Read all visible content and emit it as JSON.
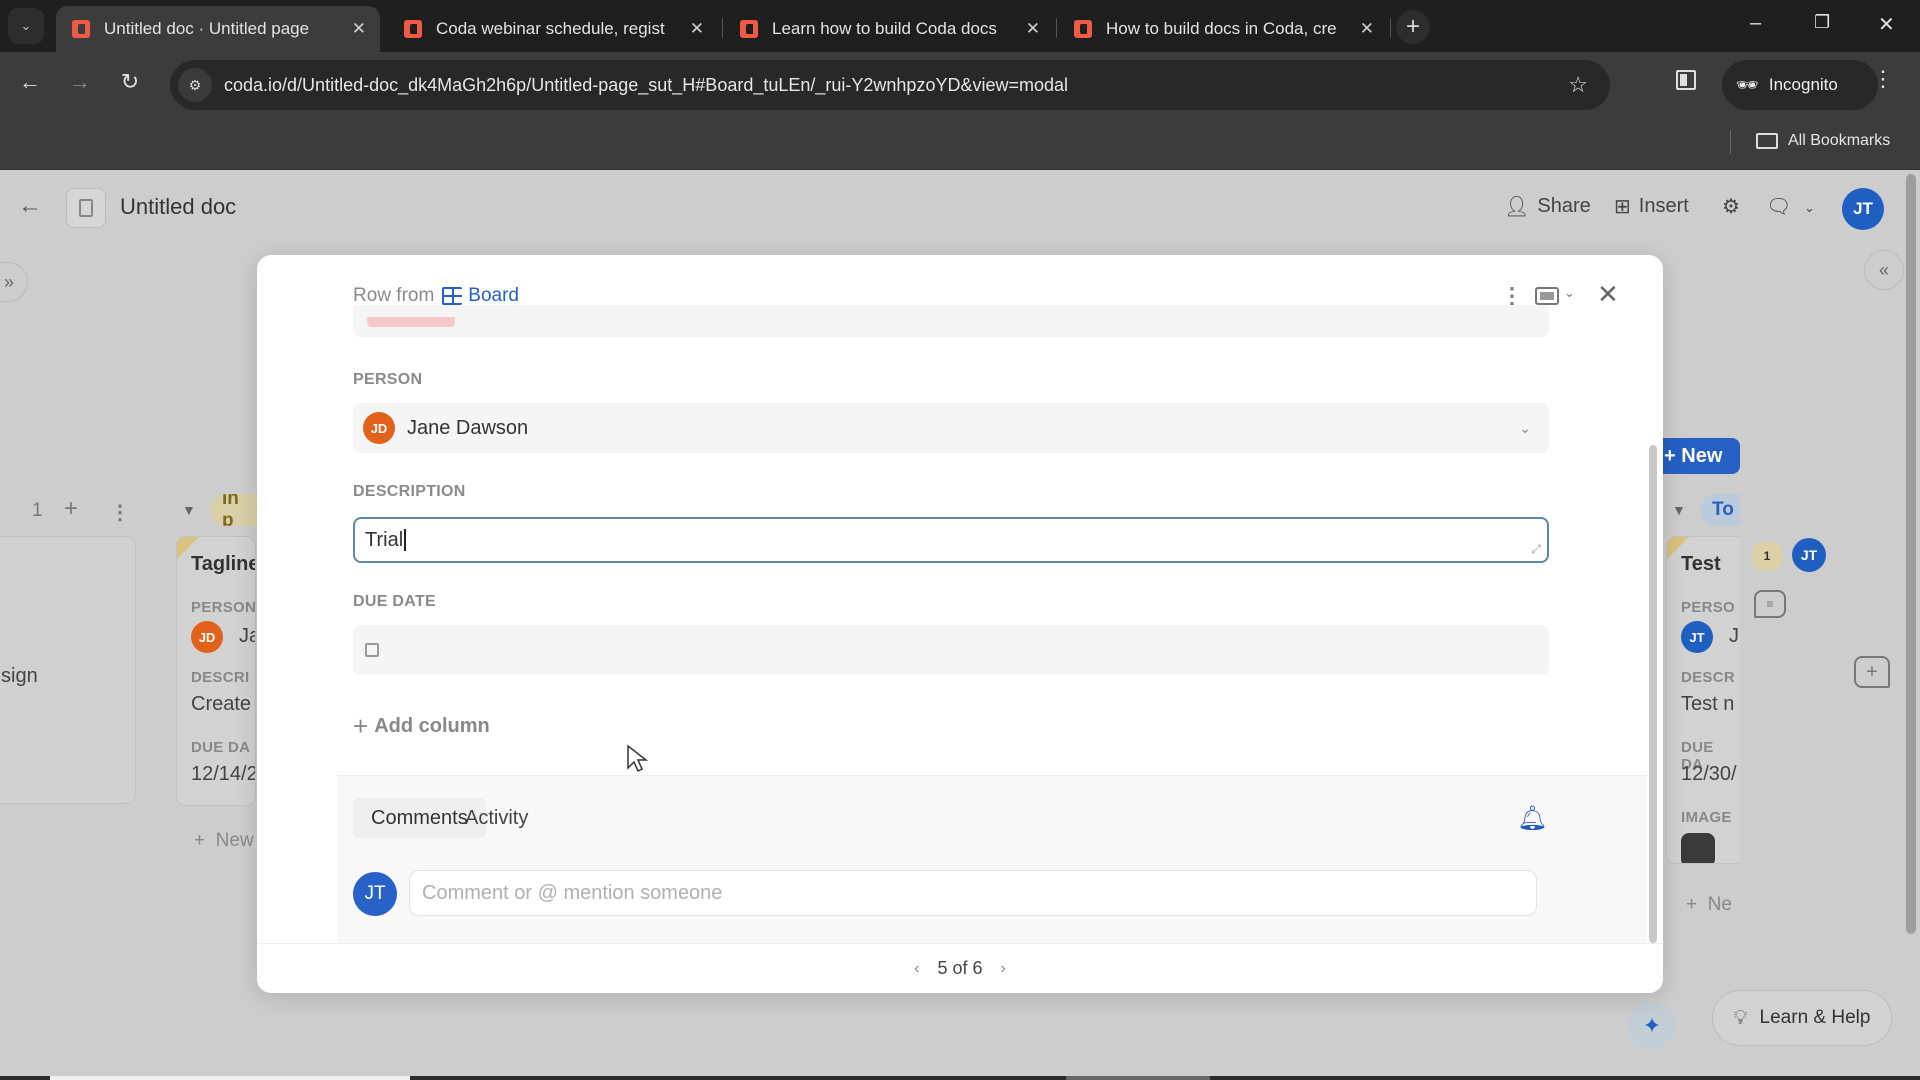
{
  "browser": {
    "tabs": [
      {
        "title": "Untitled doc · Untitled page",
        "active": true
      },
      {
        "title": "Coda webinar schedule, regist",
        "active": false
      },
      {
        "title": "Learn how to build Coda docs",
        "active": false
      },
      {
        "title": "How to build docs in Coda, cre",
        "active": false
      }
    ],
    "url": "coda.io/d/Untitled-doc_dk4MaGh2h6p/Untitled-page_sut_H#Board_tuLEn/_rui-Y2wnhpzoYD&view=modal",
    "incognito_label": "Incognito",
    "bookmarks_label": "All Bookmarks",
    "icons": {
      "tab_search": "chevron-down",
      "close_tab": "×",
      "new_tab": "+",
      "minimize": "–",
      "restore": "❐",
      "close_window": "✕",
      "back": "←",
      "forward": "→",
      "reload": "↻",
      "star": "☆",
      "kebab": "⋮"
    }
  },
  "app": {
    "doc_title": "Untitled doc",
    "header_buttons": {
      "share": "Share",
      "insert": "Insert"
    },
    "user_initials": "JT",
    "board": {
      "left_column": {
        "count": "1",
        "card_text": "sign"
      },
      "in_progress": {
        "status": "In p",
        "card": {
          "title": "Tagline",
          "person_label": "PERSON",
          "person_initials": "JD",
          "person_name": "Ja",
          "desc_label": "DESCRI",
          "desc_value": "Create",
          "due_label": "DUE DA",
          "due_value": "12/14/2"
        },
        "new_label": "New"
      },
      "todo": {
        "status": "To",
        "card": {
          "title": "Test",
          "person_label": "PERSO",
          "person_initials": "JT",
          "person_name": "J",
          "desc_label": "DESCR",
          "desc_value": "Test n",
          "due_label": "DUE DA",
          "due_value": "12/30/",
          "image_label": "IMAGE"
        },
        "new_label": "Ne"
      },
      "new_button": "New",
      "comment_count": "1",
      "comment_author": "JT"
    },
    "learn_help": "Learn & Help"
  },
  "modal": {
    "row_from": "Row from",
    "table_name": "Board",
    "fields": {
      "person_label": "PERSON",
      "person_initials": "JD",
      "person_name": "Jane Dawson",
      "description_label": "DESCRIPTION",
      "description_value": "Trial",
      "due_date_label": "DUE DATE",
      "due_date_value": ""
    },
    "add_column": "Add column",
    "tabs": [
      {
        "label": "Comments",
        "active": true
      },
      {
        "label": "Activity",
        "active": false
      }
    ],
    "commenter_initials": "JT",
    "comment_placeholder": "Comment or @ mention someone",
    "pager": {
      "current": 5,
      "total": 6,
      "label": "5 of 6"
    }
  },
  "colors": {
    "accent_blue": "#2660c4",
    "person_orange": "#e2621b",
    "coda_red": "#ef5b45",
    "focus_border": "#5d8aa8"
  }
}
